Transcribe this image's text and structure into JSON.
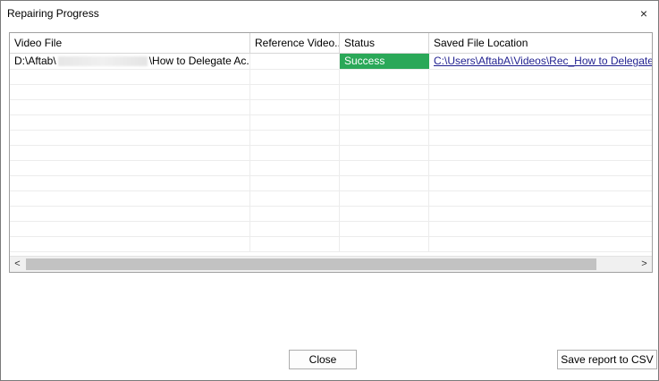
{
  "window": {
    "title": "Repairing Progress",
    "close_glyph": "×"
  },
  "table": {
    "columns": [
      "Video File",
      "Reference Video...",
      "Status",
      "Saved File Location"
    ],
    "rows": [
      {
        "video_file_prefix": "D:\\Aftab\\",
        "video_file_suffix": "\\How to Delegate Ac...",
        "reference_video": "",
        "status": "Success",
        "saved_location": "C:\\Users\\AftabA\\Videos\\Rec_How to Delegate Acc"
      }
    ],
    "empty_rows": 12
  },
  "scrollbar": {
    "left_glyph": "<",
    "right_glyph": ">"
  },
  "buttons": {
    "close": "Close",
    "save_csv": "Save report to CSV"
  },
  "colors": {
    "success": "#2aa858",
    "link": "#1f1f8f"
  },
  "icons": {
    "close": "close-icon",
    "scroll_left": "chevron-left-icon",
    "scroll_right": "chevron-right-icon"
  }
}
